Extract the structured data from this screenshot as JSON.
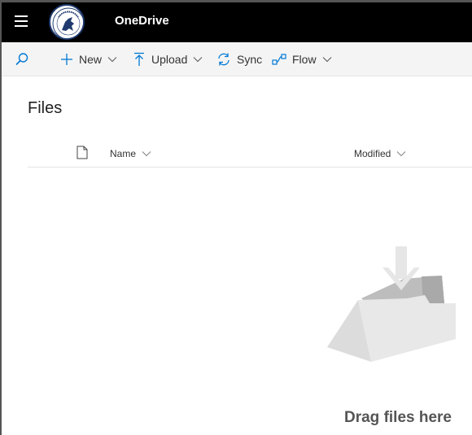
{
  "app": {
    "title": "OneDrive"
  },
  "header": {
    "menu_icon": "waffle-menu-icon",
    "logo_icon": "organization-logo"
  },
  "toolbar": {
    "search_icon": "search-icon",
    "new_label": "New",
    "upload_label": "Upload",
    "sync_label": "Sync",
    "flow_label": "Flow"
  },
  "main": {
    "title": "Files",
    "columns": {
      "name": "Name",
      "modified": "Modified"
    },
    "empty_state": {
      "message": "Drag files here",
      "icon": "folder-drop-illustration"
    }
  },
  "colors": {
    "topbar": "#000000",
    "accent": "#0078d4",
    "toolbar_bg": "#f4f4f4"
  }
}
